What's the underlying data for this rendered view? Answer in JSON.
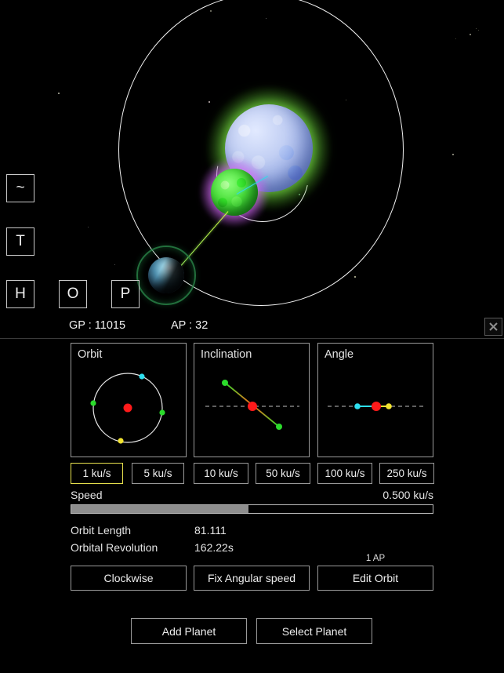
{
  "space": {
    "info": {
      "gp_label": "GP : 11015",
      "ap_label": "AP : 32"
    },
    "close_icon": "close-icon",
    "keys": [
      {
        "id": "tilde",
        "label": "~"
      },
      {
        "id": "t",
        "label": "T"
      },
      {
        "id": "h",
        "label": "H"
      },
      {
        "id": "o",
        "label": "O"
      },
      {
        "id": "p",
        "label": "P"
      }
    ],
    "bodies": [
      {
        "name": "star",
        "color": "#b8c8f0",
        "corona": "#7dff3c"
      },
      {
        "name": "moon",
        "color": "#4ee23e",
        "halo": "#dc6eff"
      },
      {
        "name": "planet",
        "color": "#4f8fae",
        "ring": "#2a8246"
      }
    ]
  },
  "panel": {
    "viz": [
      {
        "title": "Orbit",
        "name": "orbit-preview"
      },
      {
        "title": "Inclination",
        "name": "inclination-preview"
      },
      {
        "title": "Angle",
        "name": "angle-preview"
      }
    ],
    "speed_presets": [
      {
        "label": "1 ku/s",
        "active": true
      },
      {
        "label": "5 ku/s",
        "active": false
      },
      {
        "label": "10 ku/s",
        "active": false
      },
      {
        "label": "50 ku/s",
        "active": false
      },
      {
        "label": "100 ku/s",
        "active": false
      },
      {
        "label": "250 ku/s",
        "active": false
      }
    ],
    "speed": {
      "label": "Speed",
      "value": "0.500 ku/s",
      "fill_percent": 49
    },
    "stats": [
      {
        "label": "Orbit Length",
        "value": "81.111"
      },
      {
        "label": "Orbital Revolution",
        "value": "162.22s"
      }
    ],
    "actions": [
      {
        "label": "Clockwise"
      },
      {
        "label": "Fix Angular speed"
      },
      {
        "label": "Edit Orbit",
        "cost": "1 AP"
      }
    ],
    "footer": [
      {
        "label": "Add Planet"
      },
      {
        "label": "Select Planet"
      }
    ]
  },
  "chart_data": {
    "type": "scatter",
    "title": "Orbit parameter previews",
    "panels": [
      {
        "name": "Orbit",
        "type": "circle-orbit",
        "center": {
          "x": 0,
          "y": 0,
          "color": "#ff1a1a"
        },
        "radius": 40,
        "markers": [
          {
            "label": "apoapsis-node",
            "angle_deg": 66,
            "color": "#2ee0f0"
          },
          {
            "label": "node-left",
            "angle_deg": 173,
            "color": "#2bdb2b"
          },
          {
            "label": "node-right",
            "angle_deg": -8,
            "color": "#2bdb2b"
          },
          {
            "label": "periapsis",
            "angle_deg": -104,
            "color": "#f2e330"
          }
        ]
      },
      {
        "name": "Inclination",
        "type": "line-through-center",
        "reference_axis": "horizontal-dashed",
        "inclination_deg": -33,
        "endpoints": [
          {
            "label": "ascending-node",
            "color": "#2bdb2b"
          },
          {
            "label": "descending-node",
            "color": "#2bdb2b"
          }
        ],
        "center_color": "#ff1a1a",
        "line_gradient": [
          "#2bdb2b",
          "#ff6a1a",
          "#2bdb2b"
        ]
      },
      {
        "name": "Angle",
        "type": "line-through-center",
        "reference_axis": "horizontal-dashed",
        "angle_deg": 0,
        "endpoints": [
          {
            "label": "apoapsis",
            "color": "#2ee0f0"
          },
          {
            "label": "periapsis",
            "color": "#f2e330"
          }
        ],
        "center_color": "#ff1a1a"
      }
    ]
  }
}
